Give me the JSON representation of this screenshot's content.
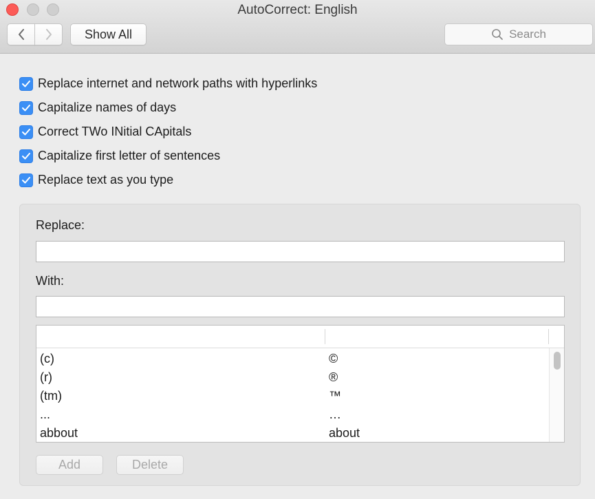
{
  "window": {
    "title": "AutoCorrect: English"
  },
  "toolbar": {
    "back_icon": "chevron-left-icon",
    "forward_icon": "chevron-right-icon",
    "show_all_label": "Show All",
    "search_placeholder": "Search"
  },
  "options": [
    {
      "label": "Replace internet and network paths with hyperlinks",
      "checked": true
    },
    {
      "label": "Capitalize names of days",
      "checked": true
    },
    {
      "label": "Correct TWo INitial CApitals",
      "checked": true
    },
    {
      "label": "Capitalize first letter of sentences",
      "checked": true
    },
    {
      "label": "Replace text as you type",
      "checked": true
    }
  ],
  "replace_panel": {
    "replace_label": "Replace:",
    "replace_value": "",
    "with_label": "With:",
    "with_value": "",
    "rows": [
      {
        "replace": "(c)",
        "with": "©"
      },
      {
        "replace": "(r)",
        "with": "®"
      },
      {
        "replace": "(tm)",
        "with": "™"
      },
      {
        "replace": "...",
        "with": "…"
      },
      {
        "replace": "abbout",
        "with": "about"
      }
    ],
    "add_label": "Add",
    "delete_label": "Delete"
  },
  "colors": {
    "accent": "#3b8ff5",
    "close_button": "#fc5b57"
  }
}
